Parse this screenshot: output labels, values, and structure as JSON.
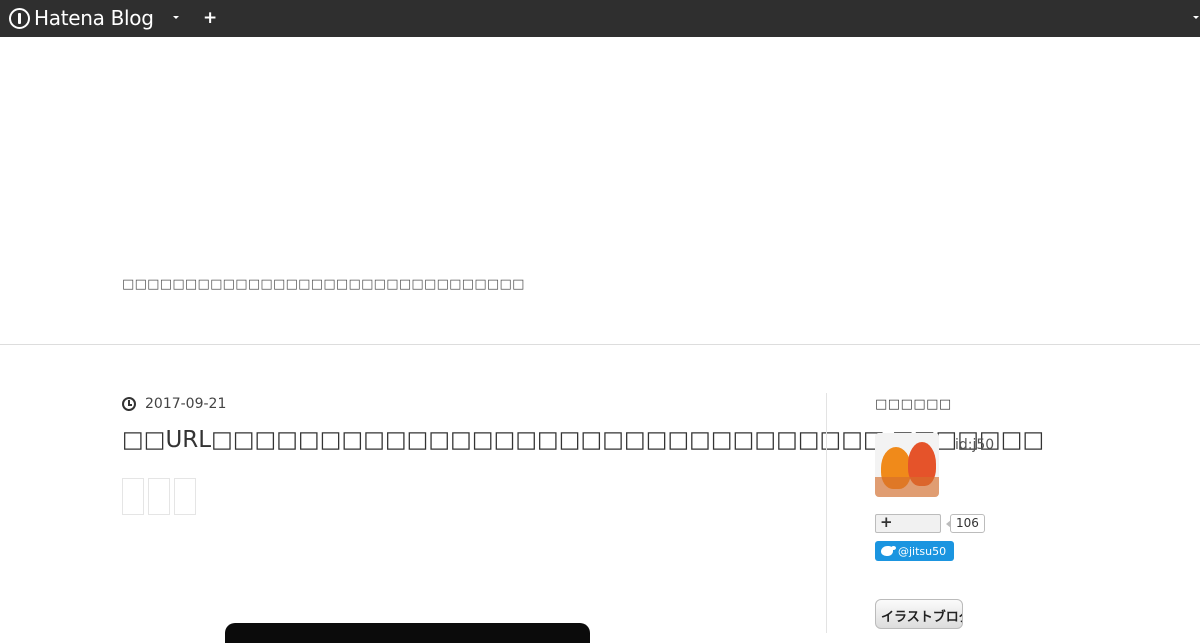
{
  "topbar": {
    "logo_text": "Hatena Blog",
    "plus_label": "+"
  },
  "header": {
    "description": "□□□□□□□□□□□□□□□□□□□□□□□□□□□□□□□□"
  },
  "entry": {
    "date": "2017-09-21",
    "title": "□□URL□□□□□□□□□□□□□□□□□□□□□□□□□□□□□□□ □□□□□□□",
    "tags": [
      "",
      "",
      ""
    ]
  },
  "sidebar": {
    "title": "□□□□□□",
    "user_id": "id:j50",
    "bookmark_count": "106",
    "twitter_handle": "@jitsu50",
    "banner_text": "イラストブログ"
  },
  "colors": {
    "topbar_bg": "#2f2f2f",
    "twitter_blue": "#1b95e0"
  }
}
